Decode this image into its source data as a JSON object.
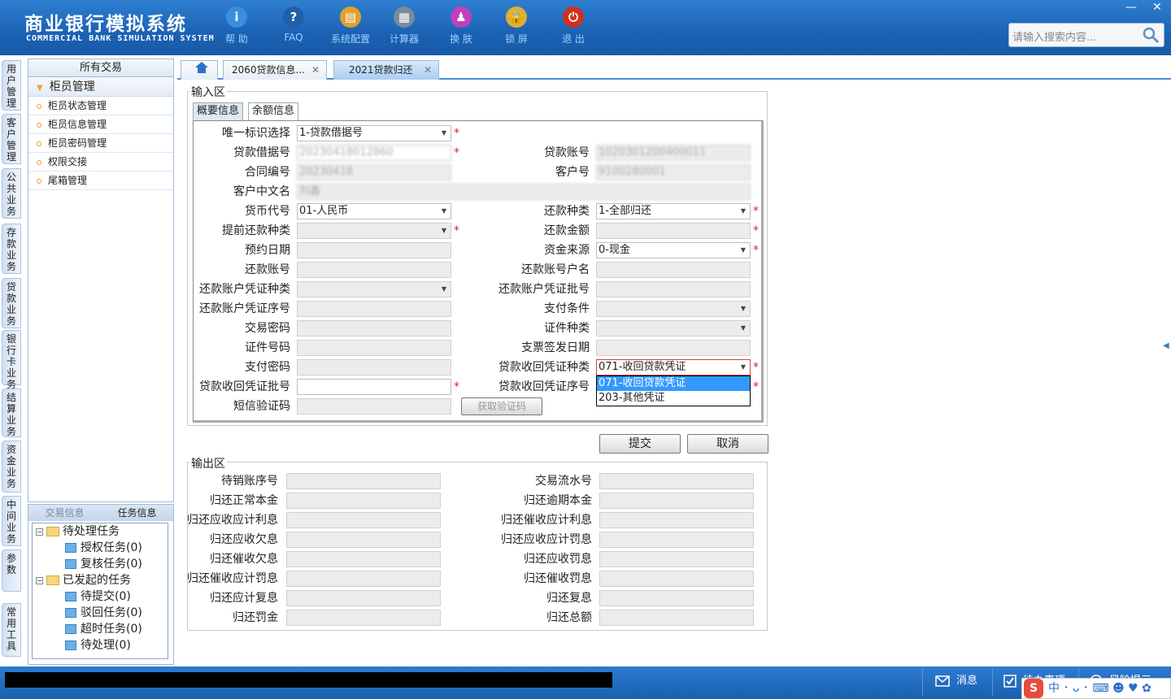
{
  "app": {
    "title_cn": "商业银行模拟系统",
    "title_en": "COMMERCIAL BANK SIMULATION SYSTEM"
  },
  "toolbar": [
    {
      "label": "帮 助",
      "icon": "info-icon",
      "color": "#3a8de0"
    },
    {
      "label": "FAQ",
      "icon": "question-icon",
      "color": "#2060a8"
    },
    {
      "label": "系统配置",
      "icon": "toolbox-icon",
      "color": "#e0a030"
    },
    {
      "label": "计算器",
      "icon": "calculator-icon",
      "color": "#7a8a9a"
    },
    {
      "label": "换 肤",
      "icon": "shirt-icon",
      "color": "#c040c0"
    },
    {
      "label": "锁 屏",
      "icon": "lock-icon",
      "color": "#e0b030"
    },
    {
      "label": "退 出",
      "icon": "power-icon",
      "color": "#d03020"
    }
  ],
  "search": {
    "placeholder": "请输入搜索内容..."
  },
  "vnav": [
    "用户管理",
    "客户管理",
    "公共业务",
    "存款业务",
    "贷款业务",
    "银行卡业务",
    "结算业务",
    "资金业务",
    "中间业务",
    "参数",
    "常用工具"
  ],
  "tree": {
    "header": "所有交易",
    "group": "柜员管理",
    "items": [
      "柜员状态管理",
      "柜员信息管理",
      "柜员密码管理",
      "权限交接",
      "尾箱管理"
    ]
  },
  "tasks": {
    "tab_trade": "交易信息",
    "tab_task": "任务信息",
    "pending": "待处理任务",
    "auth": "授权任务(0)",
    "review": "复核任务(0)",
    "launched": "已发起的任务",
    "submitted": "待提交(0)",
    "rejected": "驳回任务(0)",
    "timeout": "超时任务(0)",
    "processing": "待处理(0)"
  },
  "tabs": {
    "t1": "2060贷款信息...",
    "t2": "2021贷款归还"
  },
  "input": {
    "zone": "输入区",
    "subtab1": "概要信息",
    "subtab2": "余额信息",
    "unique_label": "唯一标识选择",
    "unique_value": "1-贷款借据号",
    "iou_label": "贷款借据号",
    "iou_value": "20230418012860",
    "loan_acct_label": "贷款账号",
    "loan_acct_value": "1020301200400011",
    "contract_label": "合同编号",
    "contract_value": "20230418",
    "cust_no_label": "客户号",
    "cust_no_value": "9100280001",
    "cust_name_label": "客户中文名",
    "cust_name_value": "刘鑫",
    "currency_label": "货币代号",
    "currency_value": "01-人民币",
    "repay_type_label": "还款种类",
    "repay_type_value": "1-全部归还",
    "prepay_label": "提前还款种类",
    "repay_amt_label": "还款金额",
    "appt_label": "预约日期",
    "fund_src_label": "资金来源",
    "fund_src_value": "0-现金",
    "repay_acct_label": "还款账号",
    "repay_acct_name_label": "还款账号户名",
    "voucher_type_label": "还款账户凭证种类",
    "voucher_batch_label": "还款账户凭证批号",
    "voucher_seq_label": "还款账户凭证序号",
    "pay_cond_label": "支付条件",
    "tx_pwd_label": "交易密码",
    "id_type_label": "证件种类",
    "id_no_label": "证件号码",
    "cheque_date_label": "支票签发日期",
    "pay_pwd_label": "支付密码",
    "recv_voucher_type_label": "贷款收回凭证种类",
    "recv_voucher_type_value": "071-收回贷款凭证",
    "recv_batch_label": "贷款收回凭证批号",
    "recv_seq_label": "贷款收回凭证序号",
    "sms_label": "短信验证码",
    "sms_btn": "获取验证码",
    "opt1": "071-收回贷款凭证",
    "opt2": "203-其他凭证"
  },
  "actions": {
    "submit": "提交",
    "cancel": "取消"
  },
  "output": {
    "zone": "输出区",
    "l": [
      "待销账序号",
      "归还正常本金",
      "归还应收应计利息",
      "归还应收欠息",
      "归还催收欠息",
      "归还催收应计罚息",
      "归还应计复息",
      "归还罚金"
    ],
    "r": [
      "交易流水号",
      "归还逾期本金",
      "归还催收应计利息",
      "归还应收应计罚息",
      "归还应收罚息",
      "归还催收罚息",
      "归还复息",
      "归还总额"
    ]
  },
  "status": {
    "msg": "消息",
    "todo": "待办事项",
    "risk": "风险提示"
  },
  "ime": {
    "logo": "S",
    "text": "中 ･ ᴗ ･ ⌨ ☻ ♥ ✿"
  }
}
